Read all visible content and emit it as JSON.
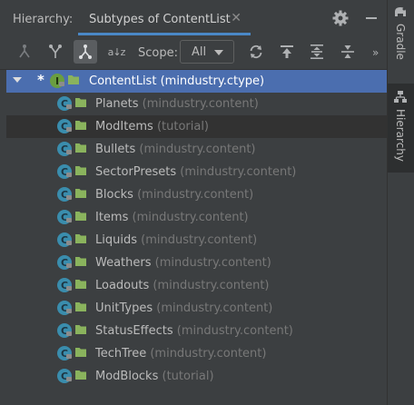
{
  "header": {
    "label": "Hierarchy:",
    "tab_label": "Subtypes of ContentList",
    "close_glyph": "✕"
  },
  "toolbar": {
    "scope_label": "Scope:",
    "scope_value": "All",
    "more_glyph": "»",
    "sort_glyph": "a↓z"
  },
  "tree": {
    "root": {
      "star": "*",
      "icon_letter": "I",
      "name": "ContentList",
      "package": "(mindustry.ctype)"
    },
    "class_icon_letter": "C",
    "items": [
      {
        "name": "Planets",
        "package": "(mindustry.content)"
      },
      {
        "name": "ModItems",
        "package": "(tutorial)"
      },
      {
        "name": "Bullets",
        "package": "(mindustry.content)"
      },
      {
        "name": "SectorPresets",
        "package": "(mindustry.content)"
      },
      {
        "name": "Blocks",
        "package": "(mindustry.content)"
      },
      {
        "name": "Items",
        "package": "(mindustry.content)"
      },
      {
        "name": "Liquids",
        "package": "(mindustry.content)"
      },
      {
        "name": "Weathers",
        "package": "(mindustry.content)"
      },
      {
        "name": "Loadouts",
        "package": "(mindustry.content)"
      },
      {
        "name": "UnitTypes",
        "package": "(mindustry.content)"
      },
      {
        "name": "StatusEffects",
        "package": "(mindustry.content)"
      },
      {
        "name": "TechTree",
        "package": "(mindustry.content)"
      },
      {
        "name": "ModBlocks",
        "package": "(tutorial)"
      }
    ]
  },
  "sidebar": {
    "gradle_label": "Gradle",
    "hierarchy_label": "Hierarchy"
  },
  "colors": {
    "panel_bg": "#3c3f41",
    "selected_row": "#4b6eaf",
    "tab_underline": "#4a88c7",
    "class_icon": "#3a8dad",
    "interface_icon": "#6a9e40"
  }
}
